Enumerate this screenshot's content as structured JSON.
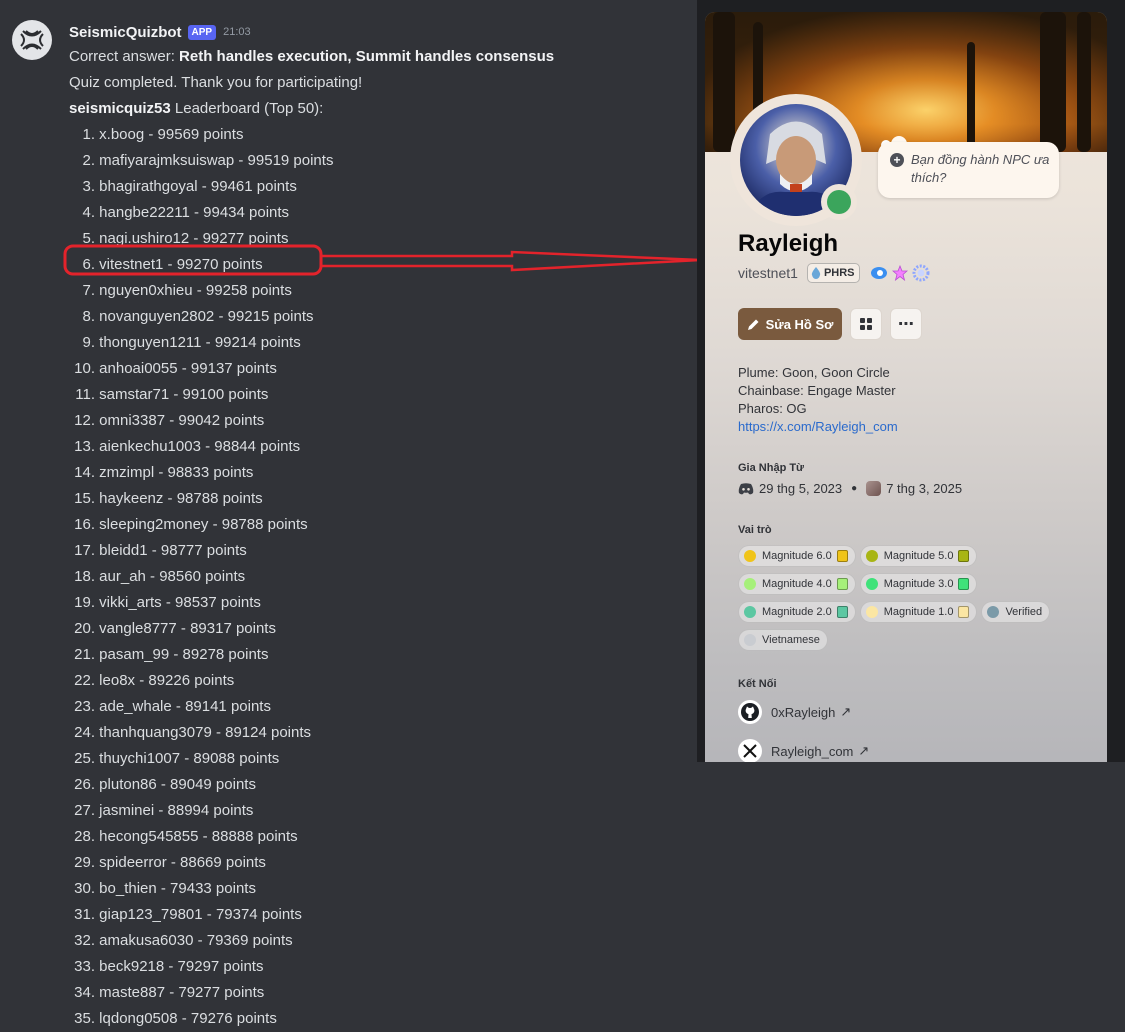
{
  "message": {
    "author": "SeismicQuizbot",
    "app_badge": "APP",
    "time": "21:03",
    "correct_prefix": "Correct answer:",
    "correct_answer": "Reth handles execution, Summit handles consensus",
    "completed": "Quiz completed. Thank you for participating!",
    "leaderboard_name": "seismicquiz53",
    "leaderboard_suffix": "Leaderboard (Top 50):",
    "leaderboard": [
      {
        "rank": "1.",
        "entry": "x.boog - 99569 points"
      },
      {
        "rank": "2.",
        "entry": "mafiyarajmksuiswap - 99519 points"
      },
      {
        "rank": "3.",
        "entry": "bhagirathgoyal - 99461 points"
      },
      {
        "rank": "4.",
        "entry": "hangbe22211 - 99434 points"
      },
      {
        "rank": "5.",
        "entry": "nagi.ushiro12 - 99277 points"
      },
      {
        "rank": "6.",
        "entry": "vitestnet1 - 99270 points"
      },
      {
        "rank": "7.",
        "entry": "nguyen0xhieu - 99258 points"
      },
      {
        "rank": "8.",
        "entry": "novanguyen2802 - 99215 points"
      },
      {
        "rank": "9.",
        "entry": "thonguyen1211 - 99214 points"
      },
      {
        "rank": "10.",
        "entry": "anhoai0055 - 99137 points"
      },
      {
        "rank": "11.",
        "entry": "samstar71 - 99100 points"
      },
      {
        "rank": "12.",
        "entry": "omni3387 - 99042 points"
      },
      {
        "rank": "13.",
        "entry": "aienkechu1003 - 98844 points"
      },
      {
        "rank": "14.",
        "entry": "zmzimpl - 98833 points"
      },
      {
        "rank": "15.",
        "entry": "haykeenz - 98788 points"
      },
      {
        "rank": "16.",
        "entry": "sleeping2money - 98788 points"
      },
      {
        "rank": "17.",
        "entry": "bleidd1 - 98777 points"
      },
      {
        "rank": "18.",
        "entry": "aur_ah - 98560 points"
      },
      {
        "rank": "19.",
        "entry": "vikki_arts - 98537 points"
      },
      {
        "rank": "20.",
        "entry": "vangle8777 - 89317 points"
      },
      {
        "rank": "21.",
        "entry": "pasam_99 - 89278 points"
      },
      {
        "rank": "22.",
        "entry": "leo8x - 89226 points"
      },
      {
        "rank": "23.",
        "entry": "ade_whale - 89141 points"
      },
      {
        "rank": "24.",
        "entry": "thanhquang3079 - 89124 points"
      },
      {
        "rank": "25.",
        "entry": "thuychi1007 - 89088 points"
      },
      {
        "rank": "26.",
        "entry": "pluton86 - 89049 points"
      },
      {
        "rank": "27.",
        "entry": "jasminei - 88994 points"
      },
      {
        "rank": "28.",
        "entry": "hecong545855 - 88888 points"
      },
      {
        "rank": "29.",
        "entry": "spideerror - 88669 points"
      },
      {
        "rank": "30.",
        "entry": "bo_thien - 79433 points"
      },
      {
        "rank": "31.",
        "entry": "giap123_79801 - 79374 points"
      },
      {
        "rank": "32.",
        "entry": "amakusa6030 - 79369 points"
      },
      {
        "rank": "33.",
        "entry": "beck9218 - 79297 points"
      },
      {
        "rank": "34.",
        "entry": "maste887 - 79277 points"
      },
      {
        "rank": "35.",
        "entry": "lqdong0508 - 79276 points"
      }
    ]
  },
  "profile": {
    "bubble_text": "Bạn đồng hành NPC ưa thích?",
    "display_name": "Rayleigh",
    "username": "vitestnet1",
    "server_tag": "PHRS",
    "edit_button": "Sửa Hồ Sơ",
    "more_icon": "⋯",
    "bio": [
      "Plume: Goon, Goon Circle",
      "Chainbase: Engage Master",
      "Pharos: OG"
    ],
    "bio_link": "https://x.com/Rayleigh_com",
    "joined_label": "Gia Nhập Từ",
    "joined_discord": "29 thg 5, 2023",
    "joined_server": "7 thg 3, 2025",
    "roles_label": "Vai trò",
    "roles": [
      {
        "name": "Magnitude 6.0",
        "color": "#f0c419"
      },
      {
        "name": "Magnitude 5.0",
        "color": "#a8b514"
      },
      {
        "name": "Magnitude 4.0",
        "color": "#a6f07a"
      },
      {
        "name": "Magnitude 3.0",
        "color": "#3fe27a"
      },
      {
        "name": "Magnitude 2.0",
        "color": "#5cc7a2"
      },
      {
        "name": "Magnitude 1.0",
        "color": "#fbe6a3"
      },
      {
        "name": "Verified",
        "color": "#7b9aa8"
      },
      {
        "name": "Vietnamese",
        "color": "#c9ccd1"
      }
    ],
    "connections_label": "Kết Nối",
    "connections": [
      {
        "name": "0xRayleigh",
        "icon": "github-icon"
      },
      {
        "name": "Rayleigh_com",
        "icon": "x-icon"
      }
    ]
  },
  "colors": {
    "highlight": "#e3232b",
    "app_badge": "#5865f2",
    "status_online": "#3ba55c"
  }
}
